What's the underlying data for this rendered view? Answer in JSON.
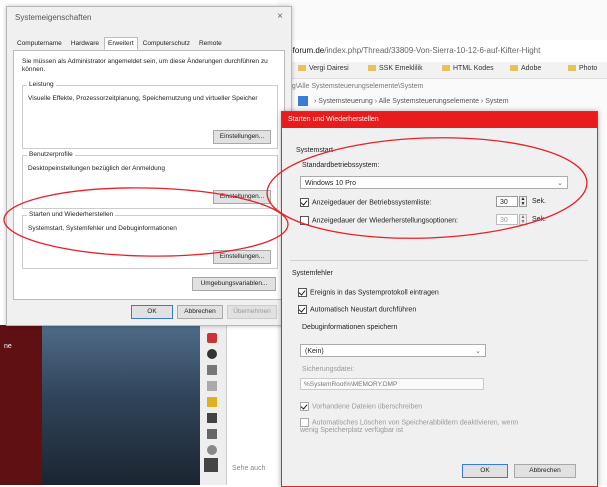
{
  "browser": {
    "url_domain": "-forum.de",
    "url_path": "/index.php/Thread/33809-Von-Sierra-10-12-6-auf-Kifter-Hight",
    "bookmarks": [
      "Vergi Dairesi",
      "SSK Emeklilik",
      "HTML Kodes",
      "Adobe",
      "Photo"
    ],
    "crumb": "ng\\Alle Systemsteuerungselemente\\System",
    "crumb2": "› Systemsteuerung › Alle Systemsteuerungselemente › System",
    "dark_label": "ne",
    "below_text": "Sehe auch"
  },
  "sysprops": {
    "title": "Systemeigenschaften",
    "close": "×",
    "tabs": [
      "Computername",
      "Hardware",
      "Erweitert",
      "Computerschutz",
      "Remote"
    ],
    "active_tab": 2,
    "note": "Sie müssen als Administrator angemeldet sein, um diese Änderungen durchführen zu können.",
    "groups": [
      {
        "label": "Leistung",
        "text": "Visuelle Effekte, Prozessorzeitplanung, Speichernutzung und virtueller Speicher",
        "button": "Einstellungen..."
      },
      {
        "label": "Benutzerprofile",
        "text": "Desktopeinstellungen bezüglich der Anmeldung",
        "button": "Einstellungen..."
      },
      {
        "label": "Starten und Wiederherstellen",
        "text": "Systemstart, Systemfehler und Debuginformationen",
        "button": "Einstellungen..."
      }
    ],
    "env_button": "Umgebungsvariablen...",
    "ok": "OK",
    "cancel": "Abbrechen",
    "apply": "Übernehmen"
  },
  "startwin": {
    "title": "Starten und Wiederherstellen",
    "systemstart": {
      "label": "Systemstart",
      "default_os_label": "Standardbetriebssystem:",
      "default_os_value": "Windows 10 Pro",
      "show_list_label": "Anzeigedauer der Betriebssystemliste:",
      "show_list_checked": true,
      "show_list_value": "30",
      "show_recovery_label": "Anzeigedauer der Wiederherstellungsoptionen:",
      "show_recovery_checked": false,
      "show_recovery_value": "30",
      "unit": "Sek."
    },
    "systemfehler": {
      "label": "Systemfehler",
      "log_label": "Ereignis in das Systemprotokoll eintragen",
      "log_checked": true,
      "restart_label": "Automatisch Neustart durchführen",
      "restart_checked": true,
      "debug_label": "Debuginformationen speichern",
      "debug_value": "(Kein)",
      "dumpfile_label": "Sicherungsdatei:",
      "dumpfile_value": "%SystemRoot%\\MEMORY.DMP",
      "overwrite_label": "Vorhandene Dateien überschreiben",
      "auto_delete_label": "Automatisches Löschen von Speicherabbildern deaktivieren, wenn wenig Speicherplatz verfügbar ist"
    },
    "ok": "OK",
    "cancel": "Abbrechen"
  },
  "colors": {
    "accent_red": "#e81c1c",
    "annotation_red": "#e8202a"
  }
}
